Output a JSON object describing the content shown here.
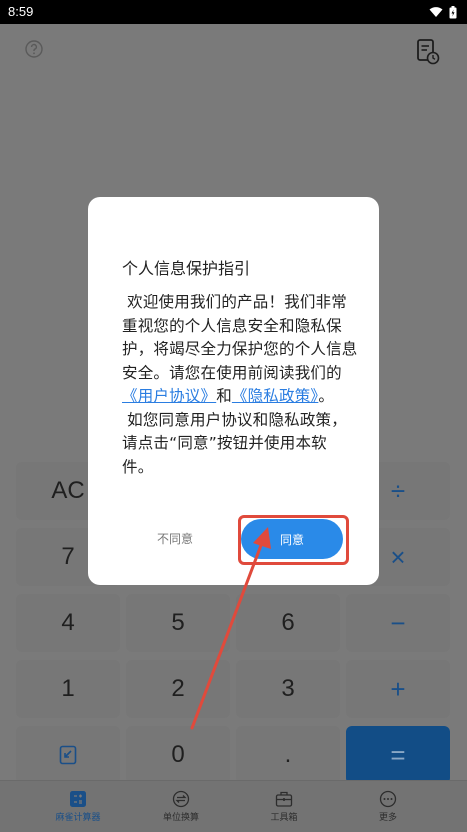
{
  "status_bar": {
    "time": "8:59"
  },
  "keypad": {
    "rows": [
      [
        "AC",
        "",
        "",
        "÷"
      ],
      [
        "7",
        "",
        "",
        "×"
      ],
      [
        "4",
        "5",
        "6",
        "−"
      ],
      [
        "1",
        "2",
        "3",
        "+"
      ],
      [
        "",
        "0",
        ".",
        "="
      ]
    ]
  },
  "tabs": [
    {
      "label": "麻雀计算器",
      "icon": "calculator-icon",
      "active": true
    },
    {
      "label": "单位换算",
      "icon": "unit-convert-icon",
      "active": false
    },
    {
      "label": "工具箱",
      "icon": "toolbox-icon",
      "active": false
    },
    {
      "label": "更多",
      "icon": "more-icon",
      "active": false
    }
  ],
  "dialog": {
    "title": "个人信息保护指引",
    "intro": "欢迎使用我们的产品！我们非常重视您的个人信息安全和隐私保护，将竭尽全力保护您的个人信息安全。请您在使用前阅读我们的",
    "link_user_agreement": "《用户协议》",
    "conj": "和",
    "link_privacy": "《隐私政策》",
    "period": "。",
    "second": "如您同意用户协议和隐私政策，请点击“同意”按钮并使用本软件。",
    "disagree_label": "不同意",
    "agree_label": "同意"
  },
  "colors": {
    "accent": "#2a8ae8",
    "annotation": "#e04a3c"
  }
}
